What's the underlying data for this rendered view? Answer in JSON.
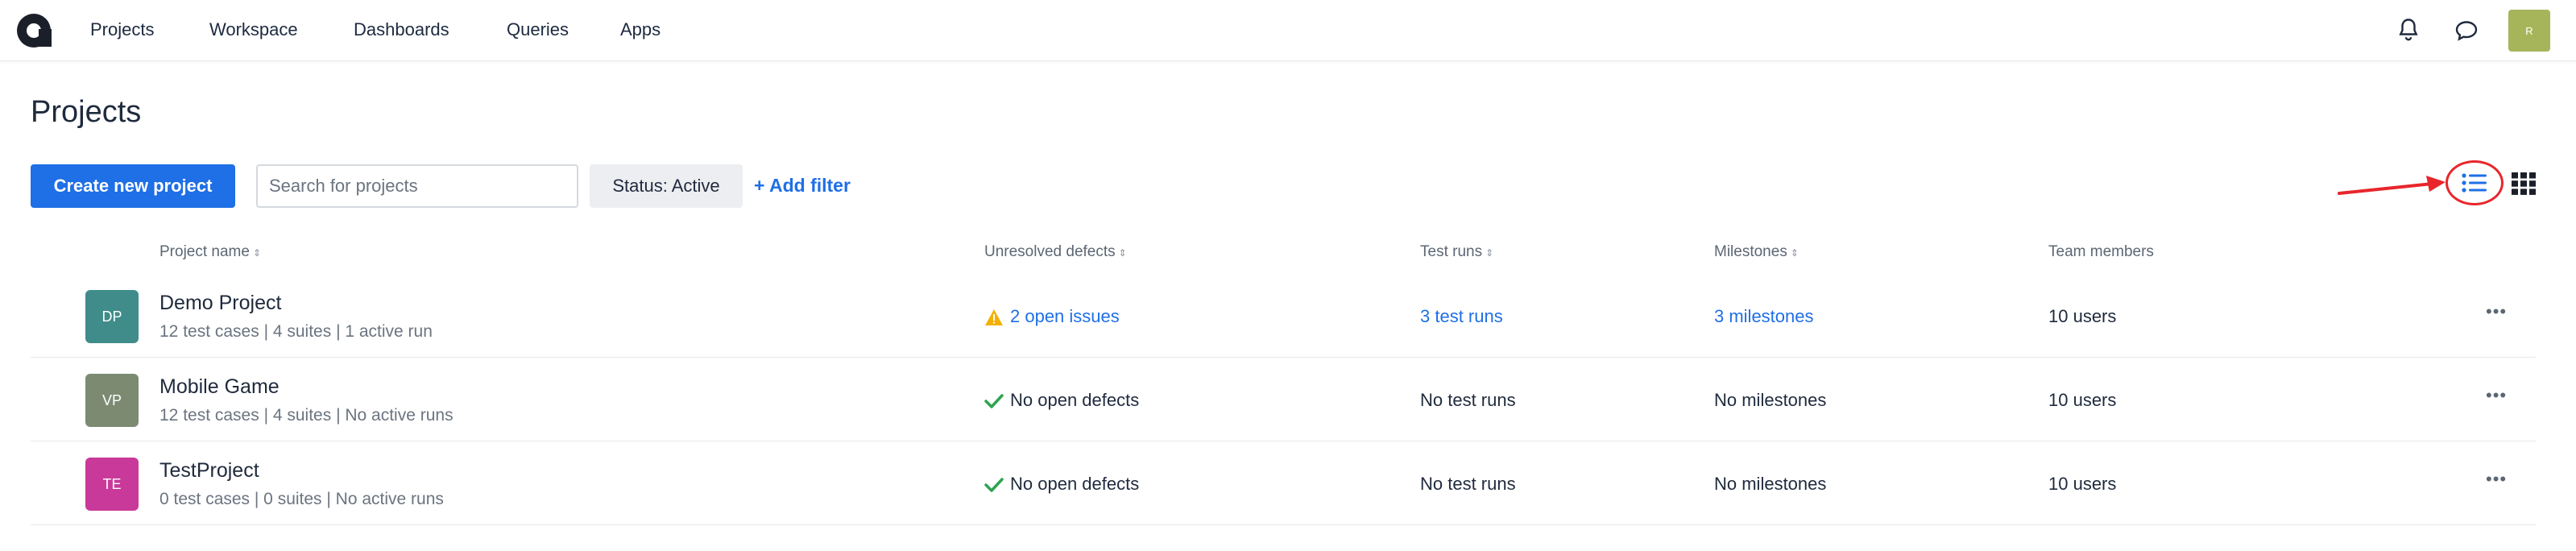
{
  "nav": {
    "items": [
      "Projects",
      "Workspace",
      "Dashboards",
      "Queries",
      "Apps"
    ],
    "user_initials": "R"
  },
  "page": {
    "title": "Projects"
  },
  "toolbar": {
    "create_label": "Create new project",
    "search_placeholder": "Search for projects",
    "status_filter": "Status: Active",
    "add_filter": "+ Add filter"
  },
  "table": {
    "headers": [
      "Project name",
      "Unresolved defects",
      "Test runs",
      "Milestones",
      "Team members"
    ],
    "rows": [
      {
        "initials": "DP",
        "avatar_color": "#3f8c8a",
        "name": "Demo Project",
        "summary": "12 test cases | 4 suites | 1 active run",
        "defects": "2 open issues",
        "defects_status": "warning",
        "runs": "3 test runs",
        "runs_link": true,
        "milestones": "3 milestones",
        "milestones_link": true,
        "members": "10 users"
      },
      {
        "initials": "VP",
        "avatar_color": "#7c8a72",
        "name": "Mobile Game",
        "summary": "12 test cases | 4 suites | No active runs",
        "defects": "No open defects",
        "defects_status": "ok",
        "runs": "No test runs",
        "runs_link": false,
        "milestones": "No milestones",
        "milestones_link": false,
        "members": "10 users"
      },
      {
        "initials": "TE",
        "avatar_color": "#c8399a",
        "name": "TestProject",
        "summary": "0 test cases | 0 suites | No active runs",
        "defects": "No open defects",
        "defects_status": "ok",
        "runs": "No test runs",
        "runs_link": false,
        "milestones": "No milestones",
        "milestones_link": false,
        "members": "10 users"
      }
    ]
  },
  "colors": {
    "accent": "#1f6fe6",
    "warning": "#f2b100",
    "ok": "#2ea44f",
    "annotation": "#e8262b"
  }
}
